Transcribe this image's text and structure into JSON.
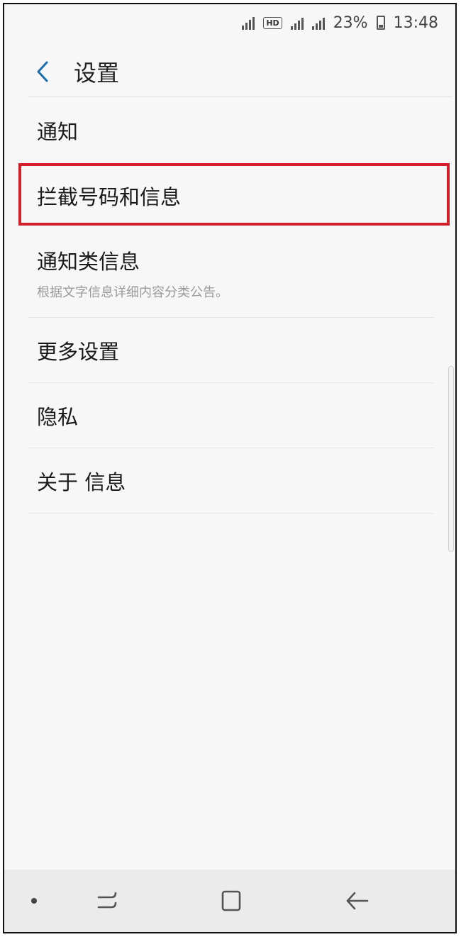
{
  "status_bar": {
    "battery_percent": "23%",
    "time": "13:48",
    "hd_label": "HD"
  },
  "header": {
    "title": "设置"
  },
  "settings_list": [
    {
      "label": "通知",
      "sub": ""
    },
    {
      "label": "拦截号码和信息",
      "sub": "",
      "highlighted": true
    },
    {
      "label": "通知类信息",
      "sub": "根据文字信息详细内容分类公告。"
    },
    {
      "label": "更多设置",
      "sub": ""
    },
    {
      "label": "隐私",
      "sub": ""
    },
    {
      "label": "关于 信息",
      "sub": ""
    }
  ],
  "colors": {
    "highlight": "#d0202c",
    "accent": "#1a6fb0"
  },
  "icons": {
    "back": "chevron-left-icon",
    "recent": "recent-apps-icon",
    "home": "home-icon",
    "nav_back": "back-arrow-icon"
  }
}
